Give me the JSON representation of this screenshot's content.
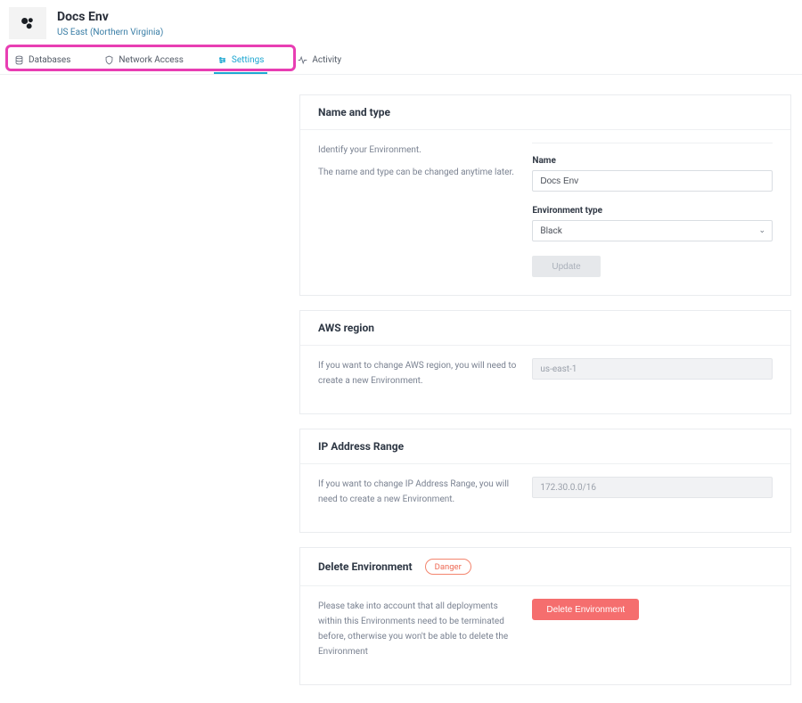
{
  "header": {
    "title": "Docs Env",
    "region": "US East (Northern Virginia)"
  },
  "tabs": {
    "databases": "Databases",
    "network": "Network Access",
    "settings": "Settings",
    "activity": "Activity"
  },
  "cards": {
    "nameType": {
      "title": "Name and type",
      "desc1": "Identify your Environment.",
      "desc2": "The name and type can be changed anytime later.",
      "nameLabel": "Name",
      "nameValue": "Docs Env",
      "typeLabel": "Environment type",
      "typeValue": "Black",
      "updateBtn": "Update"
    },
    "region": {
      "title": "AWS region",
      "desc": "If you want to change AWS region, you will need to create a new Environment.",
      "value": "us-east-1"
    },
    "ip": {
      "title": "IP Address Range",
      "desc": "If you want to change IP Address Range, you will need to create a new Environment.",
      "value": "172.30.0.0/16"
    },
    "delete": {
      "title": "Delete Environment",
      "badge": "Danger",
      "desc": "Please take into account that all deployments within this Environments need to be terminated before, otherwise you won't be able to delete the Environment",
      "btn": "Delete Environment"
    }
  }
}
